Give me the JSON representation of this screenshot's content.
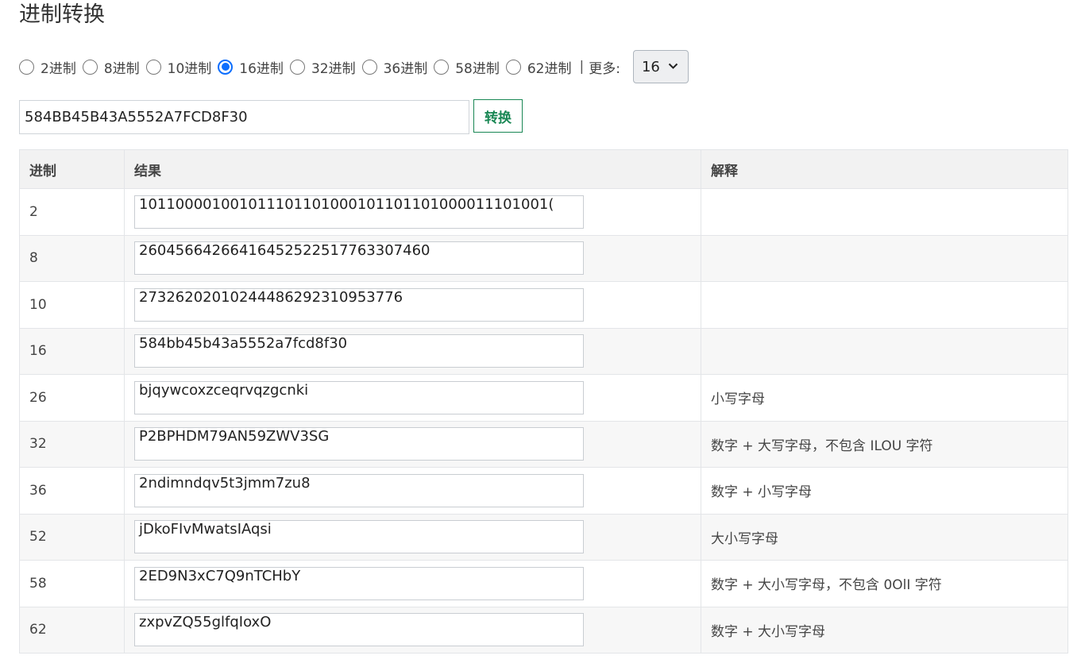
{
  "title": "进制转换",
  "radios": [
    {
      "label": "2进制",
      "checked": false
    },
    {
      "label": "8进制",
      "checked": false
    },
    {
      "label": "10进制",
      "checked": false
    },
    {
      "label": "16进制",
      "checked": true
    },
    {
      "label": "32进制",
      "checked": false
    },
    {
      "label": "36进制",
      "checked": false
    },
    {
      "label": "58进制",
      "checked": false
    },
    {
      "label": "62进制",
      "checked": false
    }
  ],
  "separator": "|",
  "more_label": "更多:",
  "select_value": "16",
  "input_value": "584BB45B43A5552A7FCD8F30",
  "convert_label": "转换",
  "table": {
    "headers": [
      "进制",
      "结果",
      "解释"
    ],
    "rows": [
      {
        "base": "2",
        "result": "101100001001011101101000101101101000011101001(",
        "explain": ""
      },
      {
        "base": "8",
        "result": "26045664266416452522517763307460",
        "explain": ""
      },
      {
        "base": "10",
        "result": "27326202010244486292310953776",
        "explain": ""
      },
      {
        "base": "16",
        "result": "584bb45b43a5552a7fcd8f30",
        "explain": ""
      },
      {
        "base": "26",
        "result": "bjqywcoxzceqrvqzgcnki",
        "explain": "小写字母"
      },
      {
        "base": "32",
        "result": "P2BPHDM79AN59ZWV3SG",
        "explain": "数字 + 大写字母，不包含 ILOU 字符"
      },
      {
        "base": "36",
        "result": "2ndimndqv5t3jmm7zu8",
        "explain": "数字 + 小写字母"
      },
      {
        "base": "52",
        "result": "jDkoFIvMwatsIAqsi",
        "explain": "大小写字母"
      },
      {
        "base": "58",
        "result": "2ED9N3xC7Q9nTCHbY",
        "explain": "数字 + 大小写字母，不包含 0OlI 字符"
      },
      {
        "base": "62",
        "result": "zxpvZQ55glfqIoxO",
        "explain": "数字 + 大小写字母"
      }
    ]
  }
}
